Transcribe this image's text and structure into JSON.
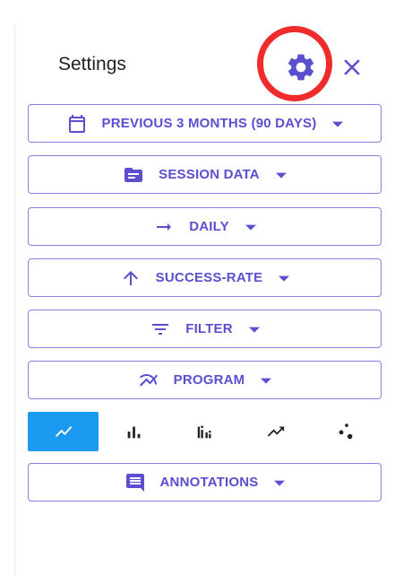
{
  "header": {
    "title": "Settings"
  },
  "colors": {
    "accent": "#5a4fcf",
    "outline": "#8a7ee6",
    "active_tab": "#1a9af0",
    "highlight": "#ef2b2b"
  },
  "dropdowns": [
    {
      "label": "PREVIOUS 3 MONTHS (90 DAYS)",
      "icon": "calendar-icon"
    },
    {
      "label": "SESSION DATA",
      "icon": "folder-icon"
    },
    {
      "label": "DAILY",
      "icon": "arrow-right-icon"
    },
    {
      "label": "SUCCESS-RATE",
      "icon": "arrow-up-icon"
    },
    {
      "label": "FILTER",
      "icon": "filter-icon"
    },
    {
      "label": "PROGRAM",
      "icon": "multi-line-icon"
    },
    {
      "label": "ANNOTATIONS",
      "icon": "comment-icon"
    }
  ],
  "chart_types": [
    {
      "icon": "line-chart-icon",
      "active": true
    },
    {
      "icon": "bar-chart-icon",
      "active": false
    },
    {
      "icon": "grouped-bar-chart-icon",
      "active": false
    },
    {
      "icon": "trending-up-icon",
      "active": false
    },
    {
      "icon": "scatter-chart-icon",
      "active": false
    }
  ]
}
